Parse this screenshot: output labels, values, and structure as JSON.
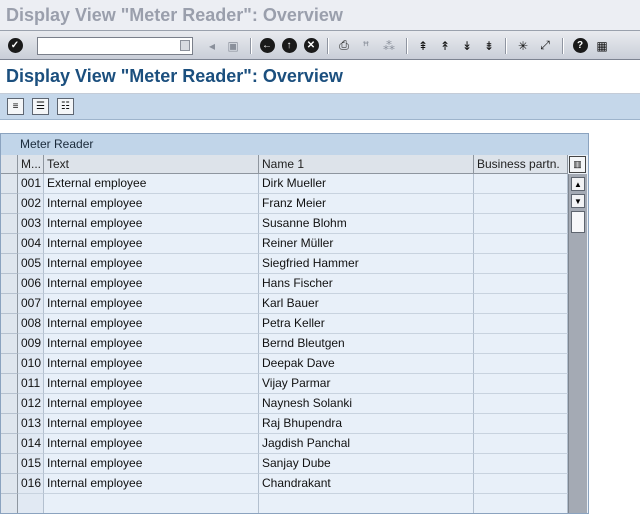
{
  "window": {
    "title": "Display View \"Meter Reader\": Overview"
  },
  "system_toolbar": {
    "command_field": {
      "value": "",
      "placeholder": ""
    },
    "icons": [
      "enter-icon",
      "save-icon",
      "back-icon",
      "exit-icon",
      "cancel-icon",
      "print-icon",
      "find-icon",
      "find-next-icon",
      "first-page-icon",
      "previous-page-icon",
      "next-page-icon",
      "last-page-icon",
      "new-session-icon",
      "shortcut-icon",
      "help-icon",
      "customize-layout-icon"
    ]
  },
  "screen": {
    "title": "Display View \"Meter Reader\": Overview"
  },
  "app_toolbar": {
    "icons": [
      "details-icon",
      "select-all-icon",
      "select-block-icon"
    ]
  },
  "table": {
    "caption": "Meter Reader",
    "columns": [
      "M...",
      "Text",
      "Name 1",
      "Business partn."
    ],
    "rows": [
      [
        "001",
        "External employee",
        "Dirk Mueller",
        ""
      ],
      [
        "002",
        "Internal employee",
        "Franz Meier",
        ""
      ],
      [
        "003",
        "Internal employee",
        "Susanne Blohm",
        ""
      ],
      [
        "004",
        "Internal employee",
        "Reiner Müller",
        ""
      ],
      [
        "005",
        "Internal employee",
        "Siegfried Hammer",
        ""
      ],
      [
        "006",
        "Internal employee",
        "Hans Fischer",
        ""
      ],
      [
        "007",
        "Internal employee",
        "Karl Bauer",
        ""
      ],
      [
        "008",
        "Internal employee",
        "Petra Keller",
        ""
      ],
      [
        "009",
        "Internal employee",
        "Bernd Bleutgen",
        ""
      ],
      [
        "010",
        "Internal employee",
        "Deepak Dave",
        ""
      ],
      [
        "011",
        "Internal employee",
        "Vijay Parmar",
        ""
      ],
      [
        "012",
        "Internal employee",
        "Naynesh Solanki",
        ""
      ],
      [
        "013",
        "Internal employee",
        "Raj Bhupendra",
        ""
      ],
      [
        "014",
        "Internal employee",
        "Jagdish Panchal",
        ""
      ],
      [
        "015",
        "Internal employee",
        "Sanjay Dube",
        ""
      ],
      [
        "016",
        "Internal employee",
        "Chandrakant",
        ""
      ]
    ]
  },
  "colors": {
    "title_text": "#1b4f7e",
    "table_bg": "#e8f0f9",
    "header_bg": "#dde3ea",
    "app_toolbar_bg": "#c5d7ea"
  }
}
